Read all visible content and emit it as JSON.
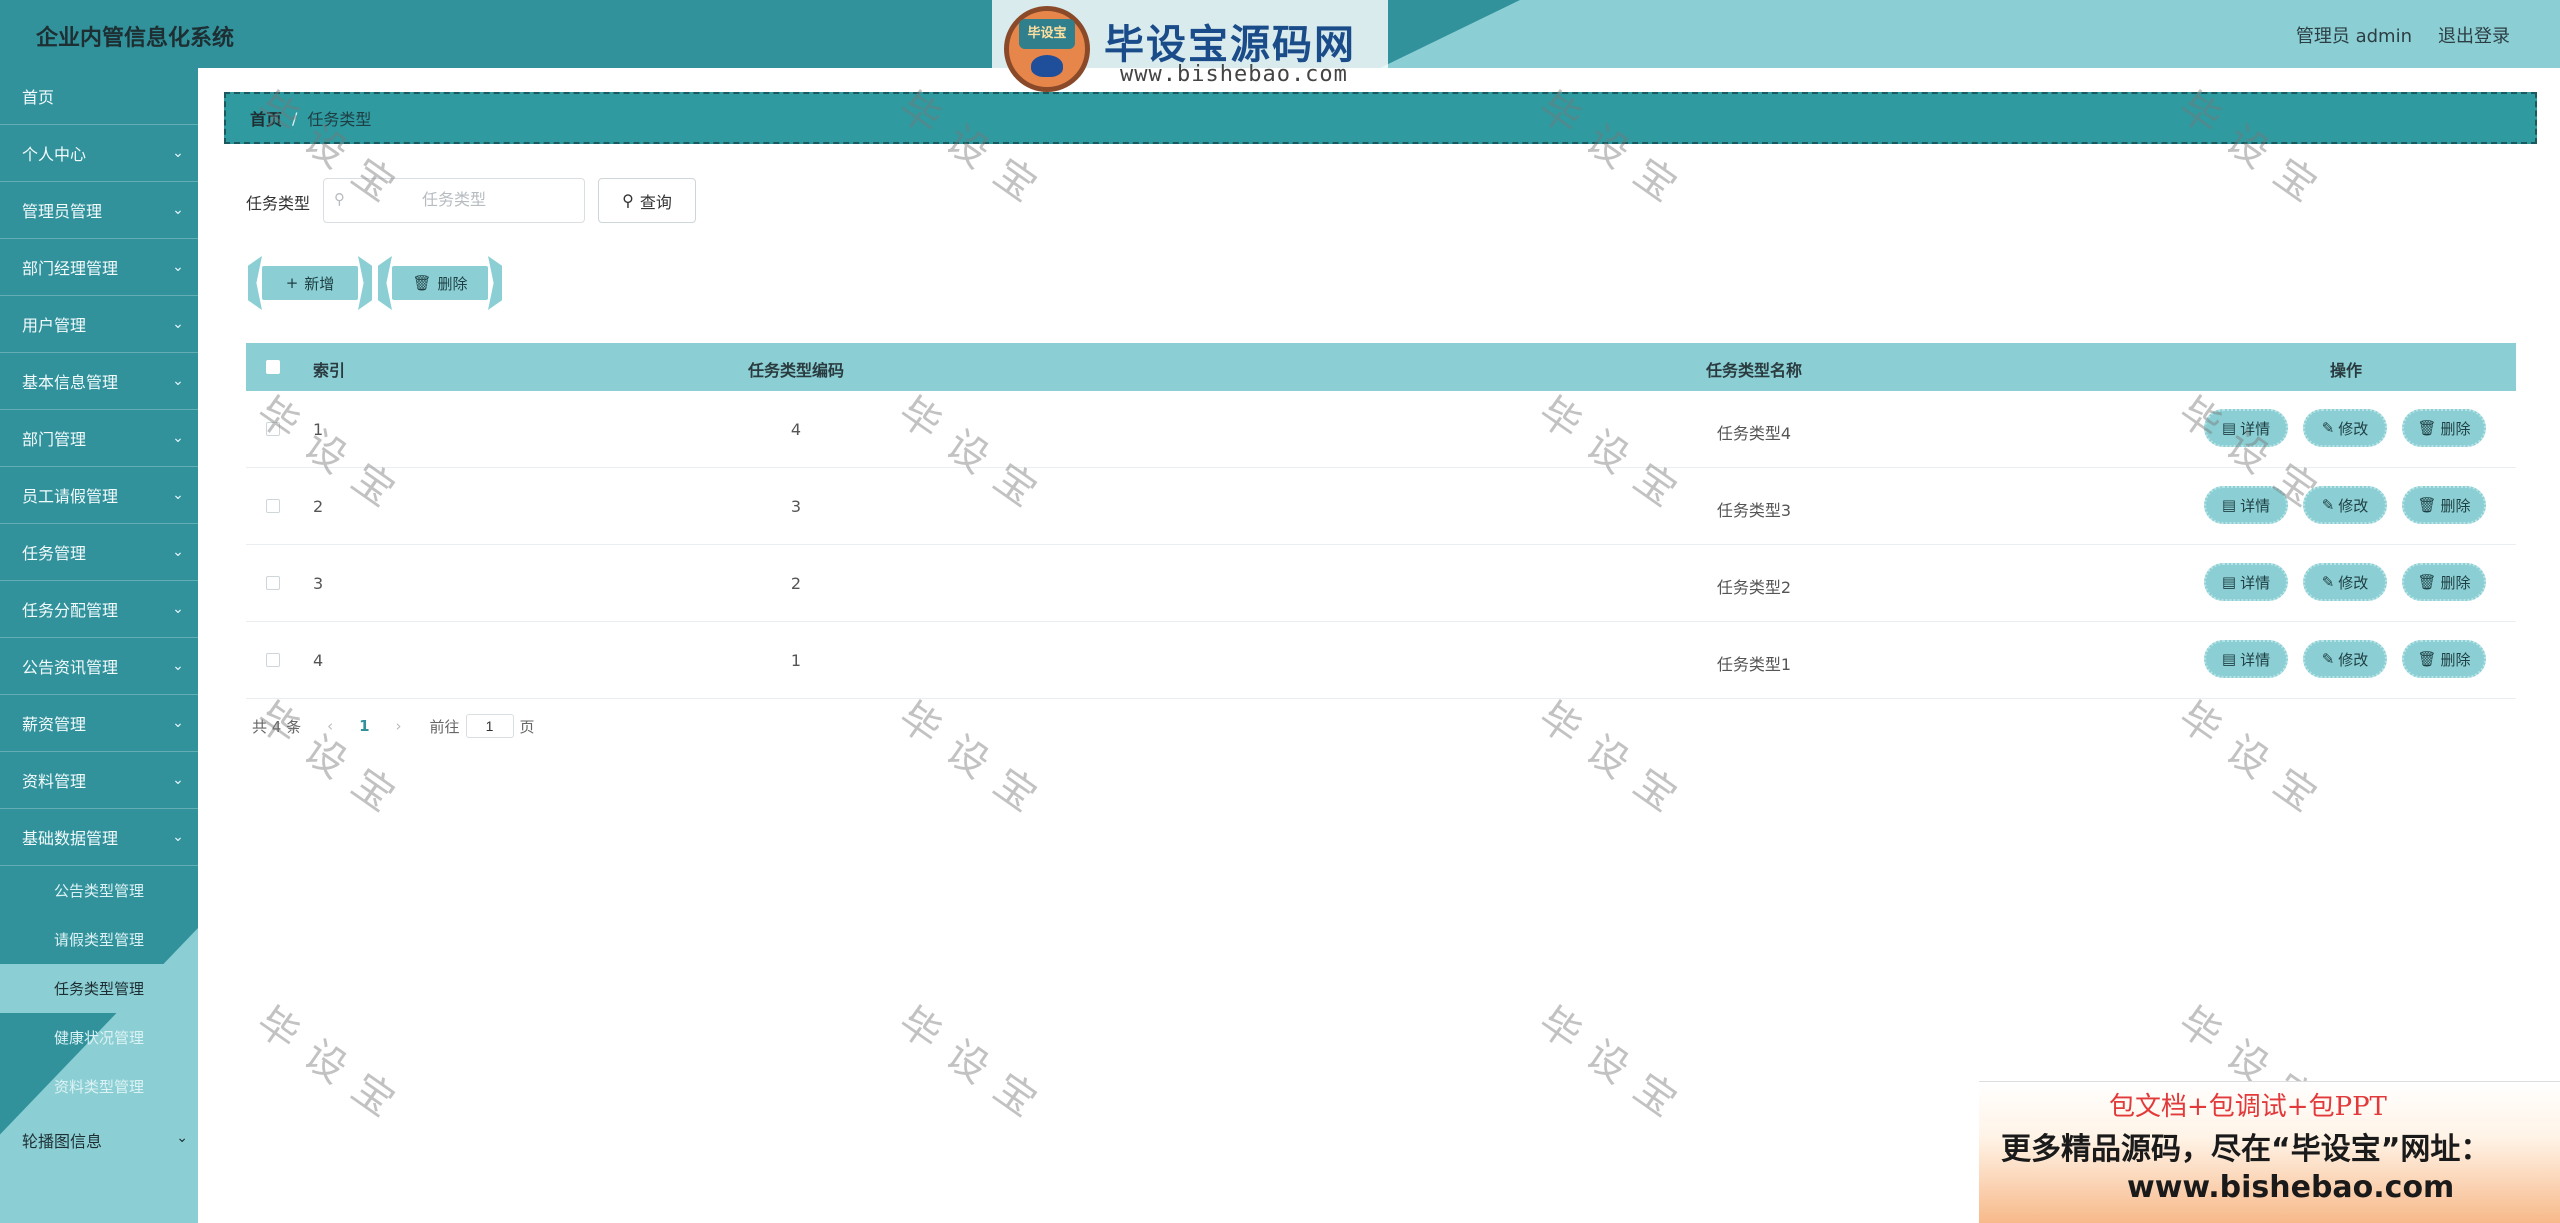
{
  "header": {
    "title": "企业内管信息化系统",
    "admin": "管理员 admin",
    "logout": "退出登录"
  },
  "logo": {
    "badge": "毕设宝",
    "title": "毕设宝源码网",
    "url": "www.bishebao.com"
  },
  "sidebar": {
    "items": [
      {
        "label": "首页",
        "has_arrow": false
      },
      {
        "label": "个人中心",
        "has_arrow": true
      },
      {
        "label": "管理员管理",
        "has_arrow": true
      },
      {
        "label": "部门经理管理",
        "has_arrow": true
      },
      {
        "label": "用户管理",
        "has_arrow": true
      },
      {
        "label": "基本信息管理",
        "has_arrow": true
      },
      {
        "label": "部门管理",
        "has_arrow": true
      },
      {
        "label": "员工请假管理",
        "has_arrow": true
      },
      {
        "label": "任务管理",
        "has_arrow": true
      },
      {
        "label": "任务分配管理",
        "has_arrow": true
      },
      {
        "label": "公告资讯管理",
        "has_arrow": true
      },
      {
        "label": "薪资管理",
        "has_arrow": true
      },
      {
        "label": "资料管理",
        "has_arrow": true
      },
      {
        "label": "基础数据管理",
        "has_arrow": true
      }
    ],
    "sub_items": [
      {
        "label": "公告类型管理",
        "active": false
      },
      {
        "label": "请假类型管理",
        "active": false
      },
      {
        "label": "任务类型管理",
        "active": true
      },
      {
        "label": "健康状况管理",
        "active": false
      },
      {
        "label": "资料类型管理",
        "active": false
      }
    ],
    "last_item": "轮播图信息"
  },
  "breadcrumb": {
    "home": "首页",
    "current": "任务类型"
  },
  "search": {
    "label": "任务类型",
    "placeholder": "任务类型",
    "query_button": "查询"
  },
  "actions": {
    "add": "新增",
    "delete": "删除"
  },
  "table": {
    "headers": {
      "index": "索引",
      "code": "任务类型编码",
      "name": "任务类型名称",
      "ops": "操作"
    },
    "rows": [
      {
        "index": "1",
        "code": "4",
        "name": "任务类型4"
      },
      {
        "index": "2",
        "code": "3",
        "name": "任务类型3"
      },
      {
        "index": "3",
        "code": "2",
        "name": "任务类型2"
      },
      {
        "index": "4",
        "code": "1",
        "name": "任务类型1"
      }
    ],
    "row_buttons": {
      "detail": "详情",
      "edit": "修改",
      "delete": "删除"
    }
  },
  "pagination": {
    "total": "共 4 条",
    "current_page": "1",
    "goto_label": "前往",
    "goto_value": "1",
    "page_suffix": "页"
  },
  "watermark": "毕设宝",
  "ad": {
    "line1": "包文档+包调试+包PPT",
    "line2": "更多精品源码，尽在“毕设宝”网址：",
    "line3": "www.bishebao.com"
  },
  "colors": {
    "primary": "#31929c",
    "light": "#8bcfd4",
    "accent_text": "#1d3e42"
  }
}
